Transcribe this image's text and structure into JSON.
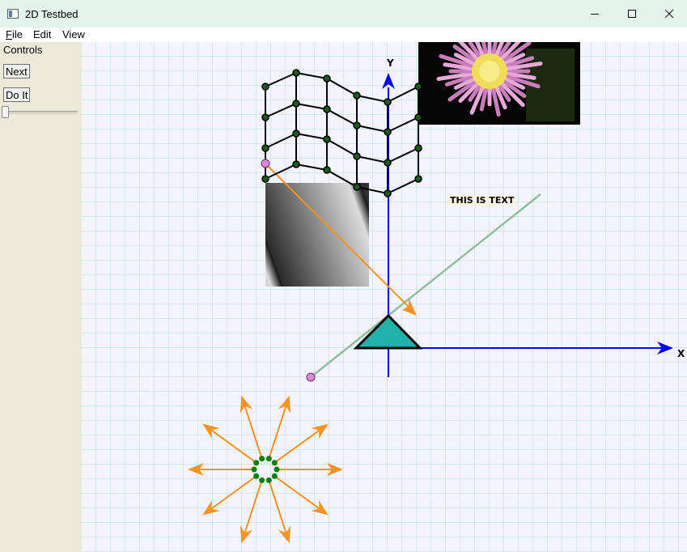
{
  "window": {
    "title": "2D Testbed"
  },
  "menu": {
    "file": "File",
    "edit": "Edit",
    "view": "View"
  },
  "panel": {
    "title": "Controls",
    "next_button": "Next",
    "doit_button": "Do It",
    "slider_value": 0
  },
  "canvas": {
    "text_label": "THIS IS TEXT",
    "x_axis_label": "X",
    "y_axis_label": "Y",
    "colors": {
      "grid_line": "#b9dbe0",
      "grid_background": "#f4f4fe",
      "axis": "#0000ff",
      "arrow": "#f7931e",
      "triangle_fill": "#20b2aa",
      "guide_line": "#8fbf9a",
      "dot": "#008000",
      "handle": "#d98bd9"
    }
  }
}
